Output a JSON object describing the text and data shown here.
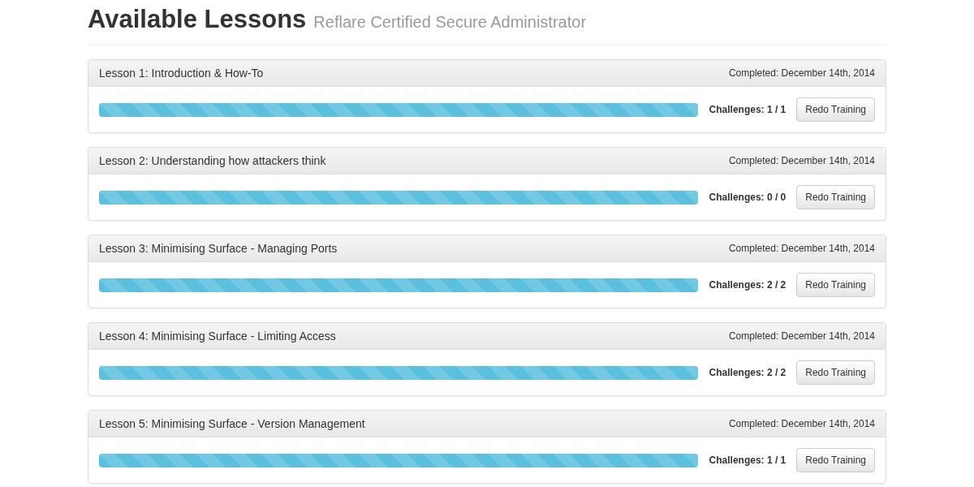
{
  "page": {
    "title": "Available Lessons",
    "subtitle": "Reflare Certified Secure Administrator"
  },
  "lessons": [
    {
      "title": "Lesson 1: Introduction & How-To",
      "completed": "Completed: December 14th, 2014",
      "level": 1,
      "challenges": "Challenges: 1 / 1",
      "button": "Redo Training"
    },
    {
      "title": "Lesson 2: Understanding how attackers think",
      "completed": "Completed: December 14th, 2014",
      "level": 1,
      "challenges": "Challenges: 0 / 0",
      "button": "Redo Training"
    },
    {
      "title": "Lesson 3: Minimising Surface - Managing Ports",
      "completed": "Completed: December 14th, 2014",
      "level": 1,
      "challenges": "Challenges: 2 / 2",
      "button": "Redo Training"
    },
    {
      "title": "Lesson 4: Minimising Surface - Limiting Access",
      "completed": "Completed: December 14th, 2014",
      "level": 1,
      "challenges": "Challenges: 2 / 2",
      "button": "Redo Training"
    },
    {
      "title": "Lesson 5: Minimising Surface - Version Management",
      "completed": "Completed: December 14th, 2014",
      "level": 1,
      "challenges": "Challenges: 1 / 1",
      "button": "Redo Training"
    }
  ]
}
